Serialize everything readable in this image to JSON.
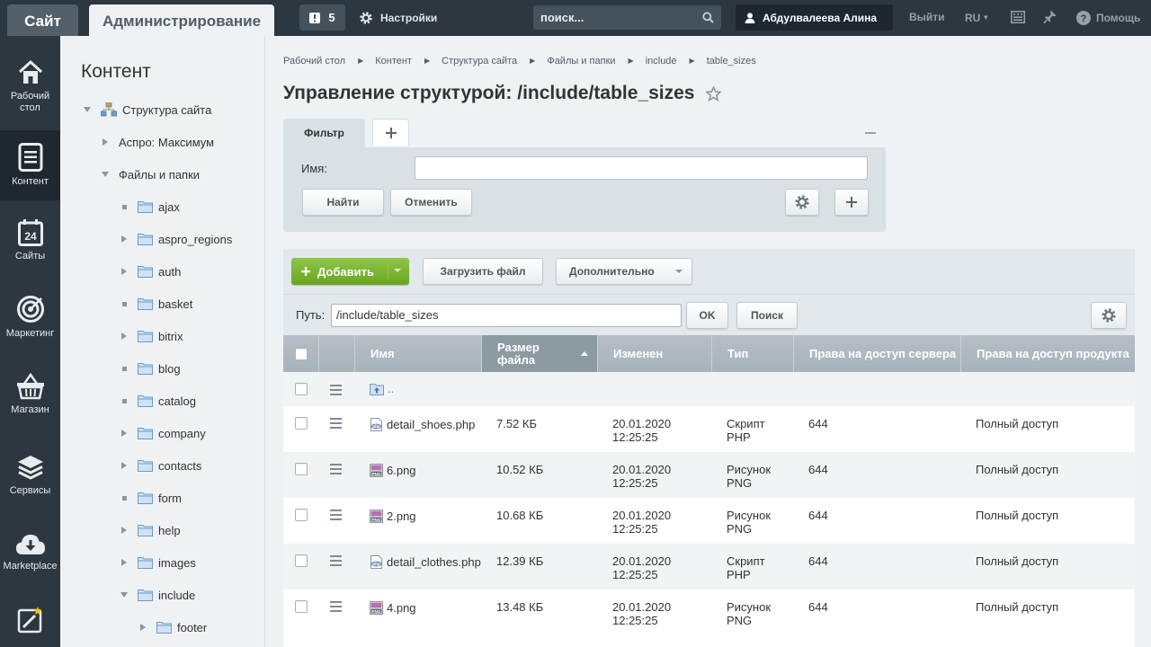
{
  "colors": {
    "topbar": "#2c3740",
    "accent_green": "#7ab435",
    "page_bg": "#eef2f4"
  },
  "topbar": {
    "site_label": "Сайт",
    "admin_label": "Администрирование",
    "notifications_count": "5",
    "settings_label": "Настройки",
    "search_placeholder": "поиск...",
    "user_name": "Абдулвалеева Алина",
    "logout_label": "Выйти",
    "lang_label": "RU",
    "help_label": "Помощь"
  },
  "leftnav": [
    {
      "label": "Рабочий стол",
      "icon": "home-icon"
    },
    {
      "label": "Контент",
      "icon": "document-icon",
      "active": true
    },
    {
      "label": "Сайты",
      "icon": "calendar-icon"
    },
    {
      "label": "Маркетинг",
      "icon": "target-icon"
    },
    {
      "label": "Магазин",
      "icon": "basket-icon"
    },
    {
      "label": "Сервисы",
      "icon": "layers-icon"
    },
    {
      "label": "Marketplace",
      "icon": "cloud-download-icon"
    },
    {
      "label": "",
      "icon": "magic-wand-icon"
    }
  ],
  "tree": {
    "title": "Контент",
    "items": [
      {
        "label": "Структура сайта",
        "toggle": "down"
      },
      {
        "label": "Аспро: Максимум",
        "toggle": "right"
      },
      {
        "label": "Файлы и папки",
        "toggle": "down"
      },
      {
        "label": "ajax",
        "toggle": "dot"
      },
      {
        "label": "aspro_regions",
        "toggle": "right"
      },
      {
        "label": "auth",
        "toggle": "right"
      },
      {
        "label": "basket",
        "toggle": "dot"
      },
      {
        "label": "bitrix",
        "toggle": "right"
      },
      {
        "label": "blog",
        "toggle": "dot"
      },
      {
        "label": "catalog",
        "toggle": "dot"
      },
      {
        "label": "company",
        "toggle": "right"
      },
      {
        "label": "contacts",
        "toggle": "right"
      },
      {
        "label": "form",
        "toggle": "dot"
      },
      {
        "label": "help",
        "toggle": "right"
      },
      {
        "label": "images",
        "toggle": "right"
      },
      {
        "label": "include",
        "toggle": "down"
      },
      {
        "label": "footer",
        "toggle": "right"
      }
    ]
  },
  "breadcrumbs": [
    "Рабочий стол",
    "Контент",
    "Структура сайта",
    "Файлы и папки",
    "include",
    "table_sizes"
  ],
  "page_title": "Управление структурой: /include/table_sizes",
  "filter": {
    "tab_label": "Фильтр",
    "name_label": "Имя:",
    "name_value": "",
    "find_label": "Найти",
    "cancel_label": "Отменить"
  },
  "toolbar": {
    "add_label": "Добавить",
    "upload_label": "Загрузить файл",
    "more_label": "Дополнительно"
  },
  "pathbar": {
    "label": "Путь:",
    "value": "/include/table_sizes",
    "ok_label": "OK",
    "search_label": "Поиск"
  },
  "table": {
    "columns": [
      "Имя",
      "Размер файла",
      "Изменен",
      "Тип",
      "Права на доступ сервера",
      "Права на доступ продукта"
    ],
    "up_row_label": "..",
    "rows": [
      {
        "name": "detail_shoes.php",
        "icon": "php-file-icon",
        "size": "7.52 КБ",
        "date": "20.01.2020",
        "time": "12:25:25",
        "type": "Скрипт PHP",
        "server_perm": "644",
        "product_perm": "Полный доступ"
      },
      {
        "name": "6.png",
        "icon": "png-file-icon",
        "size": "10.52 КБ",
        "date": "20.01.2020",
        "time": "12:25:25",
        "type": "Рисунок PNG",
        "server_perm": "644",
        "product_perm": "Полный доступ"
      },
      {
        "name": "2.png",
        "icon": "png-file-icon",
        "size": "10.68 КБ",
        "date": "20.01.2020",
        "time": "12:25:25",
        "type": "Рисунок PNG",
        "server_perm": "644",
        "product_perm": "Полный доступ"
      },
      {
        "name": "detail_clothes.php",
        "icon": "php-file-icon",
        "size": "12.39 КБ",
        "date": "20.01.2020",
        "time": "12:25:25",
        "type": "Скрипт PHP",
        "server_perm": "644",
        "product_perm": "Полный доступ"
      },
      {
        "name": "4.png",
        "icon": "png-file-icon",
        "size": "13.48 КБ",
        "date": "20.01.2020",
        "time": "12:25:25",
        "type": "Рисунок PNG",
        "server_perm": "644",
        "product_perm": "Полный доступ"
      }
    ]
  }
}
